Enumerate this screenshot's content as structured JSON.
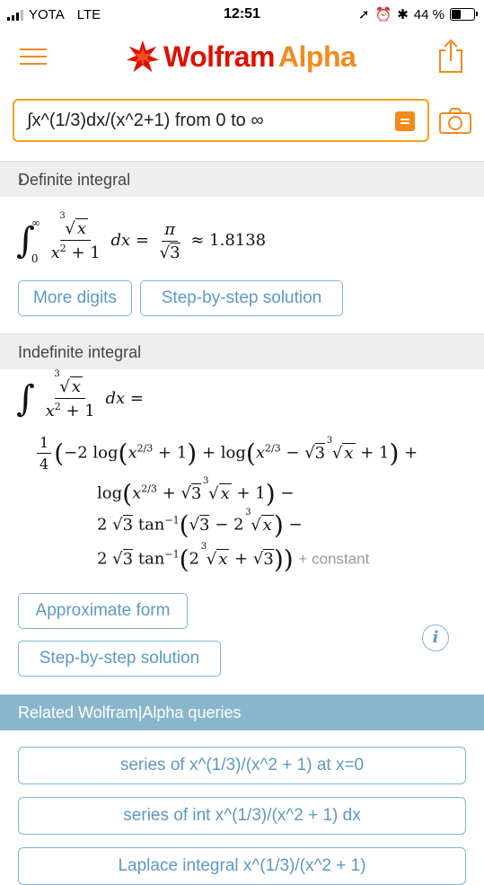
{
  "status_bar": {
    "carrier": "YOTA",
    "network": "LTE",
    "time": "12:51",
    "battery": "44 %"
  },
  "header": {
    "logo_part1": "Wolfram",
    "logo_part2": "Alpha"
  },
  "search": {
    "query": "∫x^(1/3)dx/(x^2+1) from 0 to ∞"
  },
  "definite": {
    "title": "Definite integral",
    "upper": "∞",
    "lower": "0",
    "approx": "≈ 1.8138",
    "buttons": [
      "More digits",
      "Step-by-step solution"
    ]
  },
  "indefinite": {
    "title": "Indefinite integral",
    "constant": "+ constant",
    "buttons": [
      "Approximate form",
      "Step-by-step solution"
    ]
  },
  "related": {
    "title": "Related Wolfram|Alpha queries",
    "queries": [
      "series of x^(1/3)/(x^2 + 1) at x=0",
      "series of int x^(1/3)/(x^2 + 1) dx",
      "Laplace integral x^(1/3)/(x^2 + 1)"
    ]
  },
  "colors": {
    "brand_red": "#dd1100",
    "brand_orange": "#f28b1c",
    "link_blue": "#5b9ac4",
    "related_bar": "#8ab6cc"
  }
}
